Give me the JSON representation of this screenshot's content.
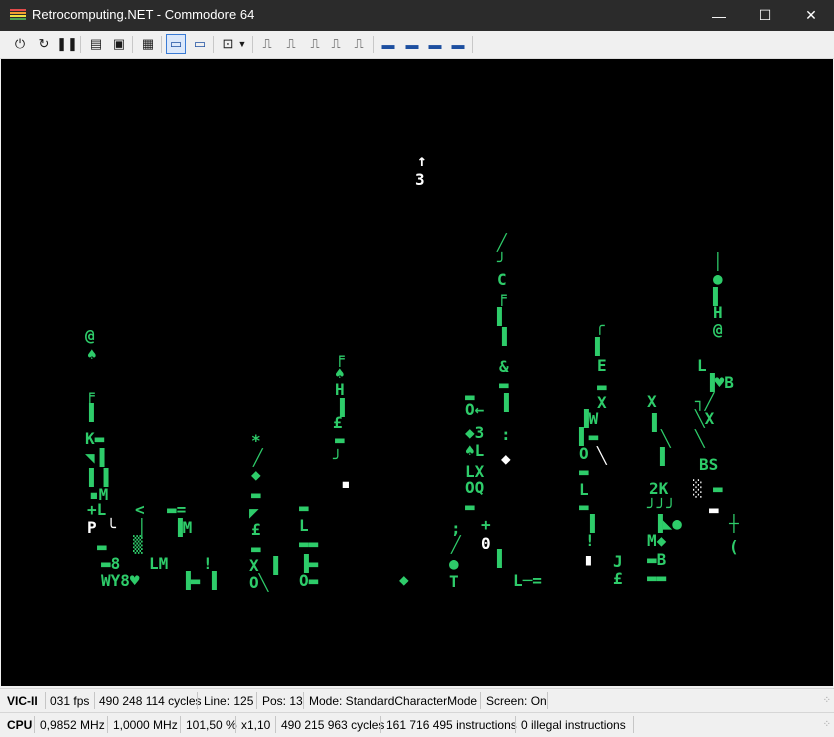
{
  "window": {
    "title": "Retrocomputing.NET - Commodore 64",
    "controls": {
      "minimize": "—",
      "maximize": "☐",
      "close": "✕"
    }
  },
  "toolbar": {
    "groups": [
      [
        "power-icon",
        "reset-icon",
        "pause-icon"
      ],
      [
        "tape-icon",
        "disk-icon"
      ],
      [
        "cartridge-icon"
      ],
      [
        "monitor-blue-icon",
        "monitor-icon"
      ],
      [
        "joystick-icon",
        "dropdown-icon"
      ],
      [
        "waveform-1-icon",
        "waveform-2-icon",
        "waveform-3-icon",
        "waveform-4-icon",
        "waveform-5-icon"
      ],
      [
        "chip-1-icon",
        "chip-2-icon",
        "chip-3-icon",
        "chip-4-icon"
      ]
    ]
  },
  "screen": {
    "colors": {
      "background": "#000000",
      "green": "#2ecc6a",
      "white": "#ffffff"
    },
    "glyphs": [
      {
        "t": "↑",
        "c": "w"
      },
      {
        "t": "3",
        "c": "w"
      },
      {
        "t": "@",
        "c": "g"
      },
      {
        "t": "♠",
        "c": "g"
      },
      {
        "t": "╒",
        "c": "g"
      },
      {
        "t": "▌",
        "c": "g"
      },
      {
        "t": "K▬",
        "c": "g"
      },
      {
        "t": "◥▐",
        "c": "g"
      },
      {
        "t": "▌▐",
        "c": "g"
      },
      {
        "t": "▪M",
        "c": "g"
      },
      {
        "t": "+L",
        "c": "g"
      },
      {
        "t": "P ╰",
        "c": "w"
      },
      {
        "t": "<",
        "c": "g"
      },
      {
        "t": "▬=",
        "c": "g"
      },
      {
        "t": "│",
        "c": "g"
      },
      {
        "t": "▐M",
        "c": "g"
      },
      {
        "t": "▬",
        "c": "g"
      },
      {
        "t": "▒",
        "c": "g"
      },
      {
        "t": "▬8",
        "c": "g"
      },
      {
        "t": "LM",
        "c": "g"
      },
      {
        "t": "!",
        "c": "g"
      },
      {
        "t": "WY8♥",
        "c": "g"
      },
      {
        "t": "▐▬",
        "c": "g"
      },
      {
        "t": "▐",
        "c": "g"
      },
      {
        "t": "*",
        "c": "g"
      },
      {
        "t": "╱",
        "c": "g"
      },
      {
        "t": "◆",
        "c": "g"
      },
      {
        "t": "▬",
        "c": "g"
      },
      {
        "t": "◤",
        "c": "g"
      },
      {
        "t": "£",
        "c": "g"
      },
      {
        "t": "▬",
        "c": "g"
      },
      {
        "t": "X ▐",
        "c": "g"
      },
      {
        "t": "O╲",
        "c": "g"
      },
      {
        "t": "▬",
        "c": "g"
      },
      {
        "t": "L",
        "c": "g"
      },
      {
        "t": "▬▬",
        "c": "g"
      },
      {
        "t": "▐▬",
        "c": "g"
      },
      {
        "t": "O▬",
        "c": "g"
      },
      {
        "t": "╒",
        "c": "g"
      },
      {
        "t": "♠",
        "c": "g"
      },
      {
        "t": "H",
        "c": "g"
      },
      {
        "t": "▐",
        "c": "g"
      },
      {
        "t": "£",
        "c": "g"
      },
      {
        "t": "▬",
        "c": "g"
      },
      {
        "t": "╯",
        "c": "g"
      },
      {
        "t": "▪",
        "c": "w"
      },
      {
        "t": "◆",
        "c": "g"
      },
      {
        "t": ";",
        "c": "g"
      },
      {
        "t": "╱",
        "c": "g"
      },
      {
        "t": "●",
        "c": "g"
      },
      {
        "t": "T",
        "c": "g"
      },
      {
        "t": "▬",
        "c": "g"
      },
      {
        "t": "O←",
        "c": "g"
      },
      {
        "t": "◆3",
        "c": "g"
      },
      {
        "t": "♠L",
        "c": "g"
      },
      {
        "t": "LX",
        "c": "g"
      },
      {
        "t": "OQ",
        "c": "g"
      },
      {
        "t": "▬",
        "c": "g"
      },
      {
        "t": "+",
        "c": "g"
      },
      {
        "t": "0",
        "c": "w"
      },
      {
        "t": "◆",
        "c": "w"
      },
      {
        "t": "╱",
        "c": "g"
      },
      {
        "t": "╯",
        "c": "g"
      },
      {
        "t": "C",
        "c": "g"
      },
      {
        "t": "╒",
        "c": "g"
      },
      {
        "t": "▌",
        "c": "g"
      },
      {
        "t": "▐",
        "c": "g"
      },
      {
        "t": "&",
        "c": "g"
      },
      {
        "t": "▬",
        "c": "g"
      },
      {
        "t": "▐",
        "c": "g"
      },
      {
        "t": ":",
        "c": "g"
      },
      {
        "t": "▌",
        "c": "g"
      },
      {
        "t": "L─=",
        "c": "g"
      },
      {
        "t": "▝",
        "c": "w"
      },
      {
        "t": "╭",
        "c": "g"
      },
      {
        "t": "▌",
        "c": "g"
      },
      {
        "t": "E",
        "c": "g"
      },
      {
        "t": "▬",
        "c": "g"
      },
      {
        "t": "X",
        "c": "g"
      },
      {
        "t": "▐W",
        "c": "g"
      },
      {
        "t": "▌▬",
        "c": "g"
      },
      {
        "t": "O",
        "c": "g"
      },
      {
        "t": "▬",
        "c": "g"
      },
      {
        "t": "L",
        "c": "g"
      },
      {
        "t": "▬",
        "c": "g"
      },
      {
        "t": "▐",
        "c": "g"
      },
      {
        "t": "!",
        "c": "g"
      },
      {
        "t": "╲",
        "c": "w"
      },
      {
        "t": "J",
        "c": "g"
      },
      {
        "t": "£",
        "c": "g"
      },
      {
        "t": "X",
        "c": "g"
      },
      {
        "t": "▐",
        "c": "g"
      },
      {
        "t": "╲",
        "c": "g"
      },
      {
        "t": "▐",
        "c": "g"
      },
      {
        "t": "2K",
        "c": "g"
      },
      {
        "t": "╯╯╯",
        "c": "g"
      },
      {
        "t": "M◆",
        "c": "g"
      },
      {
        "t": "▐◣●",
        "c": "g"
      },
      {
        "t": "▬B",
        "c": "g"
      },
      {
        "t": "▬▬",
        "c": "g"
      },
      {
        "t": "│",
        "c": "g"
      },
      {
        "t": "●",
        "c": "g"
      },
      {
        "t": "▌",
        "c": "g"
      },
      {
        "t": "H",
        "c": "g"
      },
      {
        "t": "@",
        "c": "g"
      },
      {
        "t": "L",
        "c": "g"
      },
      {
        "t": "▐♥B",
        "c": "g"
      },
      {
        "t": "┐╱",
        "c": "g"
      },
      {
        "t": "╲X",
        "c": "g"
      },
      {
        "t": "╲",
        "c": "g"
      },
      {
        "t": "BS",
        "c": "g"
      },
      {
        "t": "▬",
        "c": "g"
      },
      {
        "t": "┼",
        "c": "g"
      },
      {
        "t": "(",
        "c": "g"
      },
      {
        "t": "▬",
        "c": "w"
      },
      {
        "t": "░",
        "c": "w"
      }
    ]
  },
  "status_vic": {
    "label": "VIC-II",
    "fps": "031 fps",
    "cycles": "490 248 114 cycles",
    "line": "Line: 125",
    "pos": "Pos: 13",
    "mode": "Mode: StandardCharacterMode",
    "screen": "Screen: On"
  },
  "status_cpu": {
    "label": "CPU",
    "mhz_actual": "0,9852 MHz",
    "mhz_nominal": "1,0000 MHz",
    "percent": "101,50 %",
    "speed": "x1,10",
    "cycles": "490 215 963 cycles",
    "instructions": "161 716 495 instructions",
    "illegal": "0 illegal instructions"
  }
}
